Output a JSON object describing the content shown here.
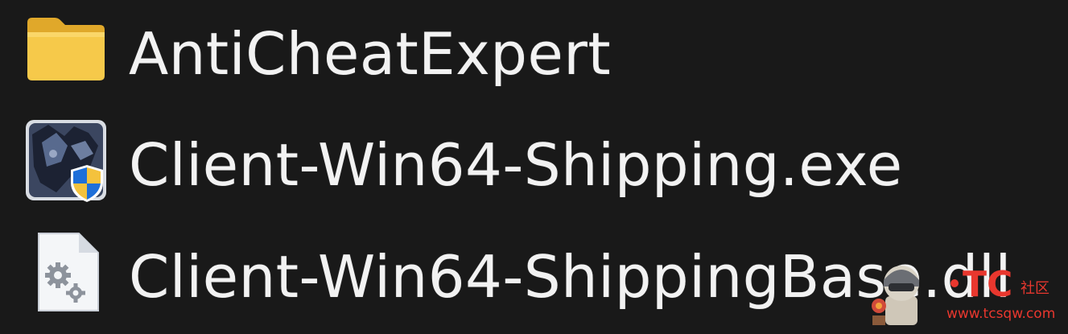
{
  "files": [
    {
      "name": "AntiCheatExpert",
      "icon": "folder-icon",
      "type": "folder"
    },
    {
      "name": "Client-Win64-Shipping.exe",
      "icon": "executable-shield-icon",
      "type": "application"
    },
    {
      "name": "Client-Win64-ShippingBase.dll",
      "icon": "dll-gear-file-icon",
      "type": "dll"
    }
  ],
  "watermark": {
    "brand": "TC",
    "sub": "社区",
    "url": "www.tcsqw.com"
  },
  "colors": {
    "background": "#191919",
    "text": "#f2f2f2",
    "folder": "#f4c23d",
    "watermark_red": "#e8372e"
  }
}
